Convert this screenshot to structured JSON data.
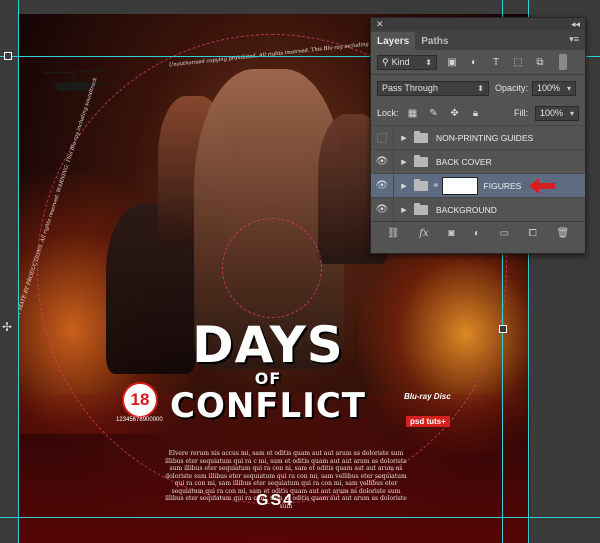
{
  "artwork": {
    "title_line1": "DAYS",
    "title_line2": "OF",
    "title_line3": "CONFLICT",
    "rating": "18",
    "barcode_number": "12345678900000",
    "bluray_label": "Blu-ray Disc",
    "psd_badge": "psd tuts+",
    "logo": "GS4",
    "blurb": "Elvere rerum nis accus mi, sam et oditis quam aut aut arum as doloriste sum illibus eter sequiatum qui ra c mi, sum et oditis quam aut aut arum as doloriste sum illibus eter sequiatum qui ra con ni, sam et oditis quam aut aut arum as doloriste sum illibus eter sequiatum qui ra con mi, sam vellibus eter sequiatum qui ra con mi, sam illibus eter sequiatum qui ra con mi, sam vellibus eter sequiatum qui ra con mi, sam et oditis quam aut aut arum as doloriste sum illibus eter sequiatum qui ra c mi, sum et oditis quam aut aut arum as doloriste sum",
    "copyright_ring": "Unauthorised copying prohibited. All rights reserved. This Blu-ray including soundtrack is protected by copyright. All rights reserved. Unauthorised",
    "copyright_left": "MADE BY MATE BY PRODUCTIONS. All rights reserved. WARNING: This Blu-ray including soundtrack"
  },
  "layers_panel": {
    "collapse_glyph": "◂◂",
    "close_glyph": "✕",
    "tabs": [
      {
        "label": "Layers",
        "active": true
      },
      {
        "label": "Paths",
        "active": false
      }
    ],
    "menu_glyph": "▾≡",
    "filter": {
      "label": "Kind",
      "icon": "search-icon"
    },
    "filter_icons": [
      "image-filter-icon",
      "adjustment-filter-icon",
      "type-filter-icon",
      "shape-filter-icon",
      "smart-object-filter-icon"
    ],
    "blend_mode": "Pass Through",
    "opacity_label": "Opacity:",
    "opacity_value": "100%",
    "lock_label": "Lock:",
    "fill_label": "Fill:",
    "fill_value": "100%",
    "layers": [
      {
        "name": "NON-PRINTING GUIDES",
        "visible": false,
        "selected": false,
        "has_mask": false
      },
      {
        "name": "BACK COVER",
        "visible": true,
        "selected": false,
        "has_mask": false
      },
      {
        "name": "FIGURES",
        "visible": true,
        "selected": true,
        "has_mask": true
      },
      {
        "name": "BACKGROUND",
        "visible": true,
        "selected": false,
        "has_mask": false
      }
    ],
    "bottom_icons": [
      "link-layers-icon",
      "fx-icon",
      "add-mask-icon",
      "adjustment-layer-icon",
      "new-group-icon",
      "new-layer-icon",
      "trash-icon"
    ],
    "arrow_color": "#d5201f",
    "selection_color": "#5d6b80"
  }
}
